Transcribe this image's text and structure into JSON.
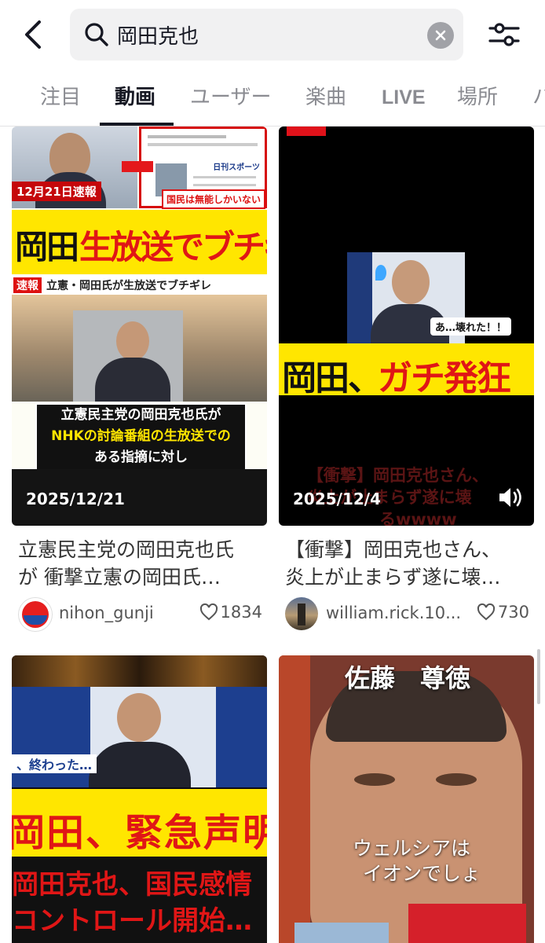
{
  "search": {
    "query": "岡田克也"
  },
  "tabs": [
    {
      "label": "注目"
    },
    {
      "label": "動画"
    },
    {
      "label": "ユーザー"
    },
    {
      "label": "楽曲"
    },
    {
      "label": "LIVE"
    },
    {
      "label": "場所"
    },
    {
      "label": "ハ"
    }
  ],
  "active_tab": "動画",
  "videos": [
    {
      "date": "2025/12/21",
      "caption_line1": "立憲民主党の岡田克也氏",
      "caption_line2": "が 衝撃立憲の岡田氏…",
      "username": "nihon_gunji",
      "likes": "1834",
      "overlay": {
        "badge_date": "12月21日速報",
        "badge_right": "国民は無能しかいない",
        "headline_black": "岡田",
        "headline_red": "生放送でブチギレ",
        "news_tag": "速報",
        "news_text": "立憲・岡田氏が生放送でブチギレ",
        "sub1": "立憲民主党の岡田克也氏が",
        "sub2": "NHKの討論番組の生放送での",
        "sub3": "ある指摘に対し",
        "paper": "日刊スポーツ"
      }
    },
    {
      "date": "2025/12/4",
      "caption_line1": "【衝撃】岡田克也さん、",
      "caption_line2": "炎上が止まらず遂に壊…",
      "username": "william.rick.10...",
      "likes": "730",
      "overlay": {
        "bubble": "あ…壊れた！！",
        "headline_black": "岡田、",
        "headline_red": "ガチ発狂",
        "faded1": "【衝撃】岡田克也さん、",
        "faded2": "炎上が止まらず遂に壊",
        "faded3": "るwwww"
      }
    },
    {
      "overlay": {
        "tag": "、終わった…",
        "headline": "岡田、緊急声明",
        "line1": "岡田克也、国民感情",
        "line2": "コントロール開始…"
      }
    },
    {
      "overlay": {
        "name": "佐藤　尊徳",
        "quote1": "ウェルシアは",
        "quote2": "イオンでしょ"
      }
    }
  ]
}
